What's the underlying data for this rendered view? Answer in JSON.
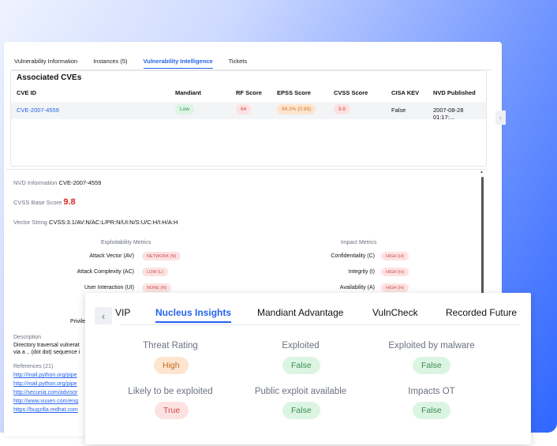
{
  "tabs": [
    {
      "label": "Vulnerability Information"
    },
    {
      "label": "Instances (5)"
    },
    {
      "label": "Vulnerability Intelligence"
    },
    {
      "label": "Tickets"
    }
  ],
  "associated": {
    "title": "Associated CVEs",
    "headers": [
      "CVE ID",
      "Mandiant",
      "RF Score",
      "EPSS Score",
      "CVSS Score",
      "CISA KEV",
      "NVD Published"
    ],
    "row": {
      "cve_id": "CVE-2007-4559",
      "mandiant": "Low",
      "rf_score": "64",
      "epss_score": "89.3% (0.89)",
      "cvss_score": "9.8",
      "cisa_kev": "False",
      "nvd_published": "2007-08-28 01:17:..."
    }
  },
  "nvd": {
    "info_label": "NVD Information",
    "info_value": "CVE-2007-4559",
    "cvss_label": "CVSS Base Score",
    "cvss_value": "9.8",
    "vector_label": "Vector String",
    "vector_value": "CVSS:3.1/AV:N/AC:L/PR:N/UI:N/S:U/C:H/I:H/A:H",
    "exploitability_head": "Exploitability Metrics",
    "impact_head": "Impact Metrics",
    "exploitability": [
      {
        "label": "Attack Vector (AV)",
        "value": "NETWORK (N)"
      },
      {
        "label": "Attack Complexity (AC)",
        "value": "LOW (L)"
      },
      {
        "label": "User Interaction (UI)",
        "value": "NONE (N)"
      }
    ],
    "impact": [
      {
        "label": "Confidentiality (C)",
        "value": "HIGH (H)"
      },
      {
        "label": "Integrity (I)",
        "value": "HIGH (H)"
      },
      {
        "label": "Availability (A)",
        "value": "HIGH (H)"
      }
    ],
    "privileges_partial": "Privile",
    "description_head": "Description",
    "description_lines": [
      "Directory traversal vulnerat",
      "via a .. (dot dot) sequence i"
    ],
    "references_head": "References (21)",
    "references": [
      "http://mail.python.org/pipe",
      "http://mail.python.org/pipe",
      "http://secunia.com/advisor",
      "http://www.vuuen.com/eng",
      "https://bugzilla.redhat.com"
    ]
  },
  "overlay": {
    "tabs": [
      "VIP",
      "Nucleus Insights",
      "Mandiant Advantage",
      "VulnCheck",
      "Recorded Future"
    ],
    "insights": [
      {
        "label": "Threat Rating",
        "value": "High"
      },
      {
        "label": "Exploited",
        "value": "False"
      },
      {
        "label": "Exploited by malware",
        "value": "False"
      },
      {
        "label": "Likely to be exploited",
        "value": "True"
      },
      {
        "label": "Public exploit available",
        "value": "False"
      },
      {
        "label": "Impacts OT",
        "value": "False"
      }
    ]
  },
  "colors": {
    "accent": "#2563eb",
    "danger": "#dc2626",
    "gradient_end": "#2f66ff"
  },
  "icons": [
    "chevron-left-icon"
  ]
}
